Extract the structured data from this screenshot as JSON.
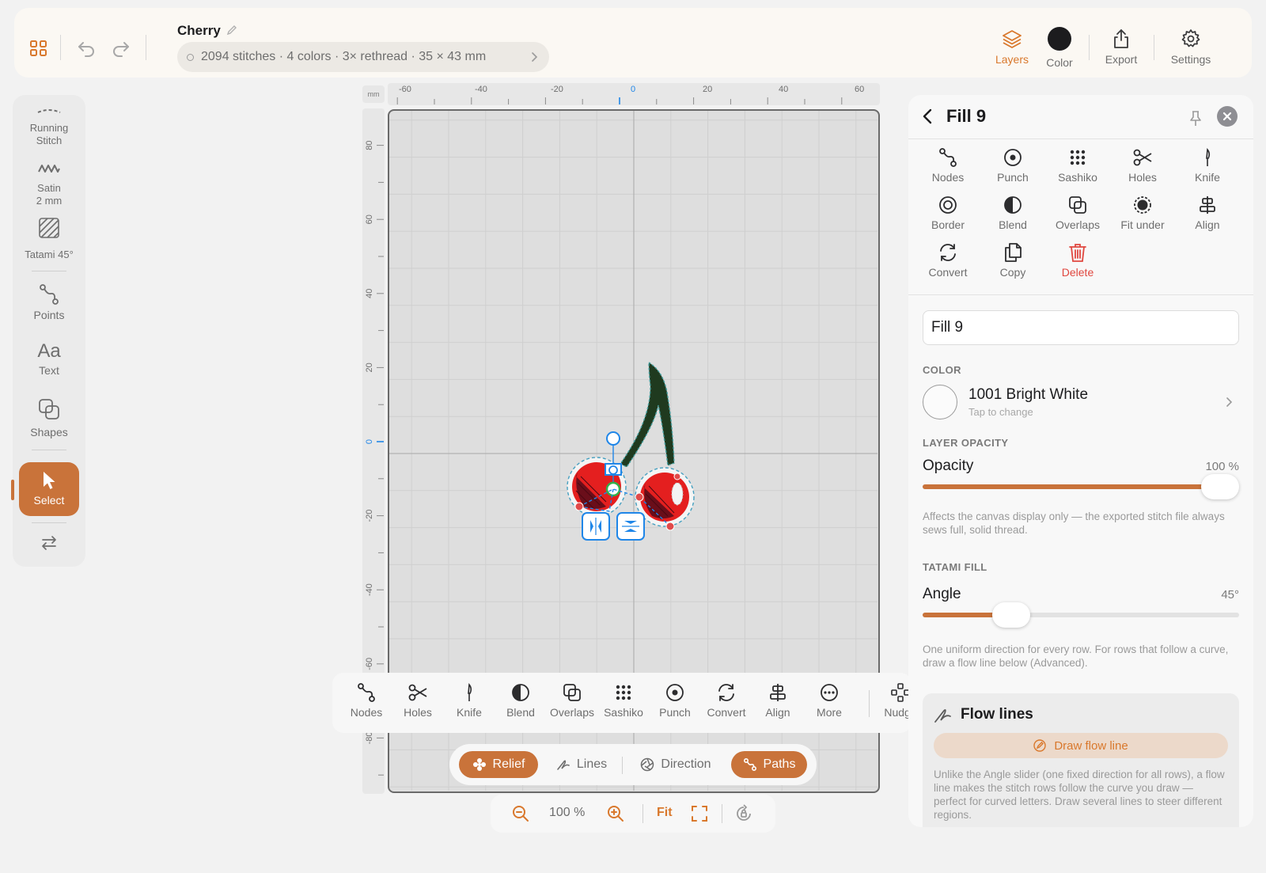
{
  "app": {
    "doc_title": "Cherry",
    "stats": "2094 stitches · 4 colors · 3× rethread · 35 × 43 mm"
  },
  "top_right": [
    {
      "label": "Layers",
      "icon": "layers-icon",
      "active": true
    },
    {
      "label": "Color",
      "icon": "color-dot"
    },
    {
      "label": "Export",
      "icon": "share-icon"
    },
    {
      "label": "Settings",
      "icon": "gear-icon"
    }
  ],
  "left_tools": {
    "running": "Running\nStitch",
    "satin": "Satin\n2 mm",
    "tatami": "Tatami 45°",
    "points": "Points",
    "text_glyph": "Aa",
    "text": "Text",
    "shapes": "Shapes",
    "select": "Select"
  },
  "ruler": {
    "unit": "mm",
    "x_ticks": [
      "-60",
      "-40",
      "-20",
      "0",
      "20",
      "40",
      "60"
    ],
    "y_ticks": [
      "80",
      "60",
      "40",
      "20",
      "0",
      "-20",
      "-40",
      "-60",
      "-80"
    ]
  },
  "canvas_tools": [
    "Nodes",
    "Holes",
    "Knife",
    "Blend",
    "Overlaps",
    "Sashiko",
    "Punch",
    "Convert",
    "Align",
    "More",
    "Nudge"
  ],
  "modes": [
    {
      "label": "Relief",
      "on": true
    },
    {
      "label": "Lines",
      "on": false
    },
    {
      "label": "Direction",
      "on": false
    },
    {
      "label": "Paths",
      "on": true
    }
  ],
  "zoom": {
    "level": "100 %",
    "fit": "Fit"
  },
  "panel": {
    "title": "Fill 9",
    "actions": [
      "Nodes",
      "Punch",
      "Sashiko",
      "Holes",
      "Knife",
      "Border",
      "Blend",
      "Overlaps",
      "Fit under",
      "Align",
      "Convert",
      "Copy",
      "Delete"
    ],
    "name_value": "Fill 9",
    "color_label": "COLOR",
    "color_name": "1001 Bright White",
    "color_hint": "Tap to change",
    "color_hex": "#fbfbfb",
    "opacity_label": "LAYER OPACITY",
    "opacity_title": "Opacity",
    "opacity_value": "100 %",
    "opacity_fraction": 1.0,
    "opacity_help": "Affects the canvas display only — the exported stitch file always sews full, solid thread.",
    "fill_label": "TATAMI FILL",
    "angle_title": "Angle",
    "angle_value": "45°",
    "angle_fraction": 0.25,
    "angle_help": "One uniform direction for every row. For rows that follow a curve, draw a flow line below (Advanced).",
    "flow_title": "Flow lines",
    "draw_flow": "Draw flow line",
    "flow_help": "Unlike the Angle slider (one fixed direction for all rows), a flow line makes the stitch rows follow the curve you draw — perfect for curved letters. Draw several lines to steer different regions."
  },
  "colors": {
    "accent": "#c9733a",
    "accent_text": "#d9782c",
    "danger": "#e0473f",
    "selection": "#1f86e8"
  }
}
